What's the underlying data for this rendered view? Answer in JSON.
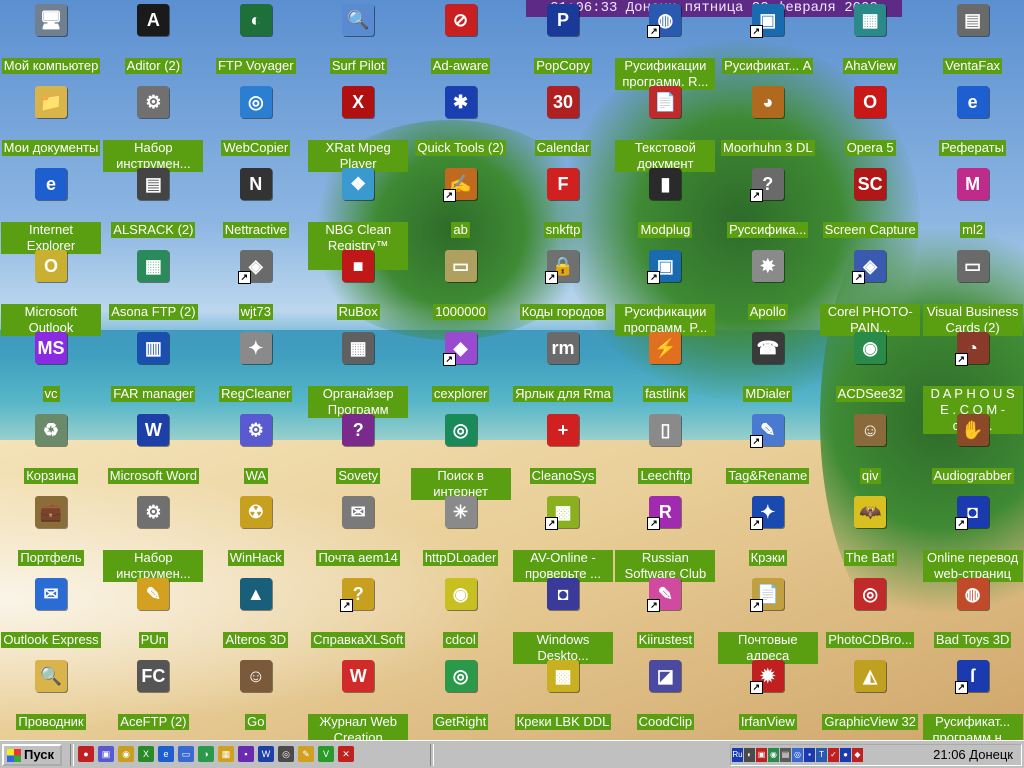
{
  "clock_banner": "21:06:33 Донецк  пятница 22 февраля 2002",
  "icons": [
    {
      "id": "my-computer",
      "label": "Мой компьютер",
      "glyph": "🖥",
      "color": "#708090",
      "shortcut": false
    },
    {
      "id": "my-documents",
      "label": "Мои документы",
      "glyph": "📁",
      "color": "#d9b44a",
      "shortcut": false
    },
    {
      "id": "internet-explorer",
      "label": "Internet Explorer",
      "glyph": "e",
      "color": "#1e5fd0",
      "shortcut": false
    },
    {
      "id": "microsoft-outlook",
      "label": "Microsoft Outlook",
      "glyph": "O",
      "color": "#c9b030",
      "shortcut": false
    },
    {
      "id": "vc",
      "label": "vc",
      "glyph": "MS",
      "color": "#8a2be2",
      "shortcut": false
    },
    {
      "id": "recycle-bin",
      "label": "Корзина",
      "glyph": "♻",
      "color": "#6a8a6a",
      "shortcut": false
    },
    {
      "id": "briefcase",
      "label": "Портфель",
      "glyph": "💼",
      "color": "#8b6d3a",
      "shortcut": false
    },
    {
      "id": "outlook-express",
      "label": "Outlook Express",
      "glyph": "✉",
      "color": "#2b6cd4",
      "shortcut": false
    },
    {
      "id": "explorer",
      "label": "Проводник",
      "glyph": "🔍",
      "color": "#d9b44a",
      "shortcut": false
    },
    {
      "id": "aditor",
      "label": "Aditor (2)",
      "glyph": "A",
      "color": "#1a1a1a",
      "shortcut": false
    },
    {
      "id": "toolkit-1",
      "label": "Набор инструмен...",
      "glyph": "⚙",
      "color": "#707070",
      "shortcut": false
    },
    {
      "id": "alsrack",
      "label": "ALSRACK (2)",
      "glyph": "▤",
      "color": "#444444",
      "shortcut": false
    },
    {
      "id": "asona-ftp",
      "label": "Asona FTP (2)",
      "glyph": "▦",
      "color": "#2a8a5a",
      "shortcut": false
    },
    {
      "id": "far-manager",
      "label": "FAR manager",
      "glyph": "▥",
      "color": "#1a4fb0",
      "shortcut": false
    },
    {
      "id": "microsoft-word",
      "label": "Microsoft Word",
      "glyph": "W",
      "color": "#1c3fa8",
      "shortcut": false
    },
    {
      "id": "toolkit-2",
      "label": "Набор инструмен...",
      "glyph": "⚙",
      "color": "#707070",
      "shortcut": false
    },
    {
      "id": "pun",
      "label": "PUn",
      "glyph": "✎",
      "color": "#d4a020",
      "shortcut": false
    },
    {
      "id": "aceftp",
      "label": "AceFTP (2)",
      "glyph": "FC",
      "color": "#555555",
      "shortcut": false
    },
    {
      "id": "ftp-voyager",
      "label": "FTP Voyager",
      "glyph": "◐",
      "color": "#1f6f3a",
      "shortcut": false
    },
    {
      "id": "webcopier",
      "label": "WebCopier",
      "glyph": "◎",
      "color": "#2c7fd0",
      "shortcut": false
    },
    {
      "id": "nettractive",
      "label": "Nettractive",
      "glyph": "N",
      "color": "#333333",
      "shortcut": false
    },
    {
      "id": "wjt73",
      "label": "wjt73",
      "glyph": "◈",
      "color": "#6a6a6a",
      "shortcut": true
    },
    {
      "id": "regcleaner",
      "label": "RegCleaner",
      "glyph": "✦",
      "color": "#8a8a8a",
      "shortcut": false
    },
    {
      "id": "wa",
      "label": "WA",
      "glyph": "⚙",
      "color": "#5a5ad0",
      "shortcut": false
    },
    {
      "id": "winhack",
      "label": "WinHack",
      "glyph": "☢",
      "color": "#c8a020",
      "shortcut": false
    },
    {
      "id": "alteros-3d",
      "label": "Alteros 3D",
      "glyph": "▲",
      "color": "#1a5f7a",
      "shortcut": false
    },
    {
      "id": "go",
      "label": "Go",
      "glyph": "☺",
      "color": "#7a5a3a",
      "shortcut": false
    },
    {
      "id": "surf-pilot",
      "label": "Surf Pilot",
      "glyph": "🔍",
      "color": "#5a8ad0",
      "shortcut": false
    },
    {
      "id": "xrat-mpeg",
      "label": "XRat Mpeg Player",
      "glyph": "X",
      "color": "#b01010",
      "shortcut": false
    },
    {
      "id": "nbg-clean",
      "label": "NBG Clean Registry™ 1.8....",
      "glyph": "❖",
      "color": "#3a9ad0",
      "shortcut": false
    },
    {
      "id": "rubox",
      "label": "RuBox",
      "glyph": "■",
      "color": "#c01818",
      "shortcut": false
    },
    {
      "id": "organizer",
      "label": "Органайзер Программ",
      "glyph": "▦",
      "color": "#606060",
      "shortcut": false
    },
    {
      "id": "sovety",
      "label": "Sovety",
      "glyph": "?",
      "color": "#7a2a8a",
      "shortcut": false
    },
    {
      "id": "mail-aem14",
      "label": "Почта aem14",
      "glyph": "✉",
      "color": "#7a7a7a",
      "shortcut": false
    },
    {
      "id": "spravka-xlsoft",
      "label": "СправкаXLSoft",
      "glyph": "?",
      "color": "#c8a020",
      "shortcut": true
    },
    {
      "id": "web-creation",
      "label": "Журнал Web Creation",
      "glyph": "W",
      "color": "#d02a2a",
      "shortcut": false
    },
    {
      "id": "ad-aware",
      "label": "Ad-aware",
      "glyph": "⊘",
      "color": "#c82020",
      "shortcut": false
    },
    {
      "id": "quick-tools",
      "label": "Quick Tools (2)",
      "glyph": "✱",
      "color": "#1a3fb0",
      "shortcut": false
    },
    {
      "id": "ab",
      "label": "ab",
      "glyph": "✍",
      "color": "#c06a20",
      "shortcut": true
    },
    {
      "id": "1000000",
      "label": "1000000",
      "glyph": "▭",
      "color": "#b0a060",
      "shortcut": false
    },
    {
      "id": "cexplorer",
      "label": "cexplorer",
      "glyph": "◆",
      "color": "#9a4ad0",
      "shortcut": true
    },
    {
      "id": "search-internet",
      "label": "Поиск в интернет",
      "glyph": "◎",
      "color": "#1a8a5a",
      "shortcut": false
    },
    {
      "id": "httpdloader",
      "label": "httpDLoader",
      "glyph": "✳",
      "color": "#8a8a8a",
      "shortcut": false
    },
    {
      "id": "cdcol",
      "label": "cdcol",
      "glyph": "◉",
      "color": "#c8c020",
      "shortcut": false
    },
    {
      "id": "getright",
      "label": "GetRight",
      "glyph": "◎",
      "color": "#2a9a4a",
      "shortcut": false
    },
    {
      "id": "popcopy",
      "label": "PopCopy",
      "glyph": "P",
      "color": "#1a3a9a",
      "shortcut": false
    },
    {
      "id": "calendar",
      "label": "Calendar",
      "glyph": "30",
      "color": "#b02020",
      "shortcut": false
    },
    {
      "id": "snkftp",
      "label": "snkftp",
      "glyph": "F",
      "color": "#d02020",
      "shortcut": false
    },
    {
      "id": "city-codes",
      "label": "Коды городов",
      "glyph": "🔒",
      "color": "#707070",
      "shortcut": true
    },
    {
      "id": "rma-shortcut",
      "label": "Ярлык для Rma",
      "glyph": "rm",
      "color": "#6a6a6a",
      "shortcut": false
    },
    {
      "id": "cleanosys",
      "label": "CleanoSys",
      "glyph": "+",
      "color": "#d02020",
      "shortcut": false
    },
    {
      "id": "av-online",
      "label": "AV-Online - проверьте ...",
      "glyph": "▩",
      "color": "#8ab020",
      "shortcut": true
    },
    {
      "id": "windows-desktop",
      "label": "Windows Deskto...",
      "glyph": "◘",
      "color": "#3a3a9a",
      "shortcut": false
    },
    {
      "id": "kreki-lbk",
      "label": "Креки LBK DDL",
      "glyph": "▩",
      "color": "#c8b020",
      "shortcut": false
    },
    {
      "id": "rusifikacii-1",
      "label": "Русификации программ. R...",
      "glyph": "◍",
      "color": "#2a5ab0",
      "shortcut": true
    },
    {
      "id": "text-document",
      "label": "Текстовой документ",
      "glyph": "📄",
      "color": "#c02a2a",
      "shortcut": false
    },
    {
      "id": "modplug",
      "label": "Modplug",
      "glyph": "▮",
      "color": "#2a2a2a",
      "shortcut": false
    },
    {
      "id": "rusifikacii-2",
      "label": "Русификации программ. P...",
      "glyph": "▣",
      "color": "#1a6ab0",
      "shortcut": true
    },
    {
      "id": "fastlink",
      "label": "fastlink",
      "glyph": "⚡",
      "color": "#e07020",
      "shortcut": false
    },
    {
      "id": "leechftp",
      "label": "Leechftp",
      "glyph": "▯",
      "color": "#8a8a8a",
      "shortcut": false
    },
    {
      "id": "russian-software-club",
      "label": "Russian Software Club",
      "glyph": "R",
      "color": "#a02ab0",
      "shortcut": true
    },
    {
      "id": "kiirustest",
      "label": "Kiirustest",
      "glyph": "✎",
      "color": "#d04aa0",
      "shortcut": true
    },
    {
      "id": "coodclip",
      "label": "CoodClip",
      "glyph": "◪",
      "color": "#4a4aa0",
      "shortcut": false
    },
    {
      "id": "rusifikat-a",
      "label": "Русификат... A",
      "glyph": "▣",
      "color": "#1a6ab0",
      "shortcut": true
    },
    {
      "id": "moorhuhn",
      "label": "Moorhuhn 3 DL",
      "glyph": "◕",
      "color": "#b06a20",
      "shortcut": false
    },
    {
      "id": "russifika",
      "label": "Руссифика...",
      "glyph": "?",
      "color": "#6a6a6a",
      "shortcut": true
    },
    {
      "id": "apollo",
      "label": "Apollo",
      "glyph": "✸",
      "color": "#8a8a8a",
      "shortcut": false
    },
    {
      "id": "mdialer",
      "label": "MDialer",
      "glyph": "☎",
      "color": "#3a3a3a",
      "shortcut": false
    },
    {
      "id": "tag-rename",
      "label": "Tag&Rename",
      "glyph": "✎",
      "color": "#4a7ad0",
      "shortcut": true
    },
    {
      "id": "kreki",
      "label": "Крэки",
      "glyph": "✦",
      "color": "#1a4ab0",
      "shortcut": true
    },
    {
      "id": "postal-addresses",
      "label": "Почтовые адреса",
      "glyph": "📄",
      "color": "#c0a040",
      "shortcut": true
    },
    {
      "id": "irfanview",
      "label": "IrfanView",
      "glyph": "✹",
      "color": "#c02020",
      "shortcut": true
    },
    {
      "id": "ahaview",
      "label": "AhaView",
      "glyph": "▦",
      "color": "#2a8a8a",
      "shortcut": false
    },
    {
      "id": "opera-5",
      "label": "Opera 5",
      "glyph": "O",
      "color": "#c81818",
      "shortcut": false
    },
    {
      "id": "screen-capture",
      "label": "Screen Capture",
      "glyph": "SC",
      "color": "#b01818",
      "shortcut": false
    },
    {
      "id": "corel-photo-paint",
      "label": "Corel PHOTO-PAIN...",
      "glyph": "◈",
      "color": "#3a5ab0",
      "shortcut": true
    },
    {
      "id": "acdsee32",
      "label": "ACDSee32",
      "glyph": "◉",
      "color": "#2a8a4a",
      "shortcut": false
    },
    {
      "id": "qiv",
      "label": "qiv",
      "glyph": "☺",
      "color": "#8a6a3a",
      "shortcut": false
    },
    {
      "id": "the-bat",
      "label": "The Bat!",
      "glyph": "🦇",
      "color": "#d8c020",
      "shortcut": false
    },
    {
      "id": "photocdbro",
      "label": "PhotoCDBro...",
      "glyph": "◎",
      "color": "#c02a2a",
      "shortcut": false
    },
    {
      "id": "graphicview-32",
      "label": "GraphicView 32",
      "glyph": "◭",
      "color": "#c0a020",
      "shortcut": false
    },
    {
      "id": "ventafax",
      "label": "VentaFax",
      "glyph": "▤",
      "color": "#6a6a6a",
      "shortcut": false
    },
    {
      "id": "referaty",
      "label": "Рефераты",
      "glyph": "e",
      "color": "#1e5fd0",
      "shortcut": false
    },
    {
      "id": "ml2",
      "label": "ml2",
      "glyph": "M",
      "color": "#c02a8a",
      "shortcut": false
    },
    {
      "id": "visual-business-cards",
      "label": "Visual Business Cards (2)",
      "glyph": "▭",
      "color": "#6a6a6a",
      "shortcut": false
    },
    {
      "id": "daphouse",
      "label": "D A P H O U S E . C O M - свеж...",
      "glyph": "◔",
      "color": "#8a3a2a",
      "shortcut": true
    },
    {
      "id": "audiograbber",
      "label": "Audiograbber",
      "glyph": "✋",
      "color": "#8a4a2a",
      "shortcut": false
    },
    {
      "id": "online-translate",
      "label": "Online перевод web-страниц",
      "glyph": "◘",
      "color": "#1a3ab0",
      "shortcut": true
    },
    {
      "id": "bad-toys-3d",
      "label": "Bad Toys 3D",
      "glyph": "◍",
      "color": "#c04a2a",
      "shortcut": false
    },
    {
      "id": "rusifikat-last",
      "label": "Русификат... программ н...",
      "glyph": "ſ",
      "color": "#1a3ab0",
      "shortcut": true
    }
  ],
  "taskbar": {
    "start_label": "Пуск",
    "quick_launch": [
      {
        "name": "ql-1",
        "glyph": "●",
        "color": "#c02020"
      },
      {
        "name": "ql-2",
        "glyph": "▣",
        "color": "#5a5ad0"
      },
      {
        "name": "ql-3",
        "glyph": "◉",
        "color": "#c8a020"
      },
      {
        "name": "ql-4",
        "glyph": "X",
        "color": "#2a8a2a"
      },
      {
        "name": "ql-5",
        "glyph": "e",
        "color": "#1e5fd0"
      },
      {
        "name": "ql-6",
        "glyph": "▭",
        "color": "#3a6ad0"
      },
      {
        "name": "ql-7",
        "glyph": "◑",
        "color": "#2a9a4a"
      },
      {
        "name": "ql-8",
        "glyph": "▦",
        "color": "#d0a020"
      },
      {
        "name": "ql-9",
        "glyph": "▪",
        "color": "#6a2ab0"
      },
      {
        "name": "ql-10",
        "glyph": "W",
        "color": "#1c3fa8"
      },
      {
        "name": "ql-11",
        "glyph": "◎",
        "color": "#4a4a4a"
      },
      {
        "name": "ql-12",
        "glyph": "✎",
        "color": "#d0a020"
      },
      {
        "name": "ql-13",
        "glyph": "V",
        "color": "#2a9a2a"
      },
      {
        "name": "ql-14",
        "glyph": "✕",
        "color": "#c02020"
      }
    ],
    "tray_icons": [
      {
        "name": "lang-indicator",
        "glyph": "Ru",
        "color": "#1a3ab0"
      },
      {
        "name": "tray-1",
        "glyph": "◐",
        "color": "#4a4a4a"
      },
      {
        "name": "tray-2",
        "glyph": "▣",
        "color": "#c02020"
      },
      {
        "name": "tray-3",
        "glyph": "◉",
        "color": "#2a8a4a"
      },
      {
        "name": "tray-4",
        "glyph": "▤",
        "color": "#5a5a5a"
      },
      {
        "name": "tray-5",
        "glyph": "◎",
        "color": "#3a6ad0"
      },
      {
        "name": "tray-6",
        "glyph": "▪",
        "color": "#1a3ab0"
      },
      {
        "name": "tray-7",
        "glyph": "T",
        "color": "#2a5ab0"
      },
      {
        "name": "tray-8",
        "glyph": "✓",
        "color": "#c02020"
      },
      {
        "name": "tray-9",
        "glyph": "●",
        "color": "#1a3ab0"
      },
      {
        "name": "tray-10",
        "glyph": "◆",
        "color": "#c02020"
      }
    ],
    "clock": "21:06 Донецк"
  }
}
